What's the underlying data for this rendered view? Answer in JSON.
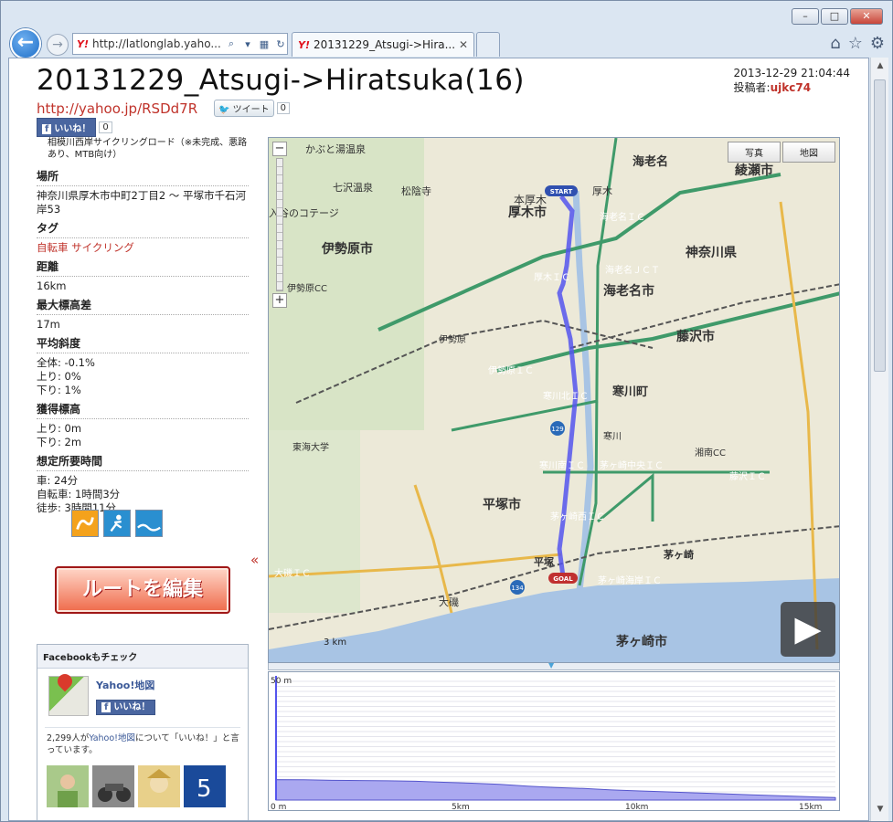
{
  "window": {
    "controls": [
      "–",
      "□",
      "✕"
    ]
  },
  "browser": {
    "url": "http://latlonglab.yaho...",
    "tab_title": "20131229_Atsugi->Hira...",
    "logo": "Y!"
  },
  "page": {
    "title": "20131229_Atsugi->Hiratsuka(16)",
    "datetime": "2013-12-29 21:04:44",
    "poster_label": "投稿者:",
    "poster": "ujkc74",
    "short_url": "http://yahoo.jp/RSDd7R",
    "tweet_label": "ツイート",
    "tweet_count": "0",
    "like_label": "いいね！",
    "like_count": "0",
    "description": "相模川西岸サイクリングロード（※未完成、悪路あり、MTB向け）"
  },
  "details": {
    "location_label": "場所",
    "location": "神奈川県厚木市中町2丁目2 〜 平塚市千石河岸53",
    "tags_label": "タグ",
    "tags": "自転車 サイクリング",
    "distance_label": "距離",
    "distance": "16km",
    "max_elev_label": "最大標高差",
    "max_elev": "17m",
    "slope_label": "平均斜度",
    "slope_all": "全体: -0.1%",
    "slope_up": "上り: 0%",
    "slope_down": "下り: 1%",
    "gain_label": "獲得標高",
    "gain_up": "上り: 0m",
    "gain_down": "下り: 2m",
    "time_label": "想定所要時間",
    "time_car": "車: 24分",
    "time_bike": "自転車: 1時間3分",
    "time_walk": "徒歩: 3時間11分"
  },
  "edit_button": "ルートを編集",
  "collapse": "«",
  "facebook": {
    "header": "Facebookもチェック",
    "page_name": "Yahoo!地図",
    "like_label": "いいね！",
    "count_text": "2,299人が",
    "count_link": "Yahoo!地図",
    "count_rest": "について「いいね！」と言っています。"
  },
  "map": {
    "zoom_in": "+",
    "zoom_out": "−",
    "type_photo": "写真",
    "type_map": "地図",
    "scale": "3 km",
    "start": "START",
    "goal": "GOAL",
    "labels": [
      "かぶと湯温泉",
      "七沢温泉",
      "松陰寺",
      "入谷のコテージ",
      "厚木市",
      "本厚木",
      "厚木",
      "海老名",
      "綾瀬市",
      "海老名ＩＣ",
      "伊勢原市",
      "厚木ＩＣ",
      "海老名ＪＣＴ",
      "神奈川県",
      "伊勢原CC",
      "海老名市",
      "伊勢原",
      "藤沢市",
      "伊勢原ＩＣ",
      "寒川北ＩＣ",
      "寒川町",
      "東海大学",
      "寒川",
      "寒川南ＩＣ",
      "茅ヶ崎中央ＩＣ",
      "藤沢ＩＣ",
      "平塚市",
      "茅ヶ崎西ＩＣ",
      "茅ヶ崎",
      "平塚",
      "茅ヶ崎海岸ＩＣ",
      "大磯ＩＣ",
      "大磯",
      "茅ヶ崎市",
      "湘南CC"
    ],
    "road_signs": [
      "129",
      "134"
    ]
  },
  "elevation": {
    "y_top": "50 m",
    "x_labels": [
      "0 m",
      "5km",
      "10km",
      "15km"
    ],
    "profile": [
      8.5,
      8.4,
      8.2,
      8.1,
      8.0,
      7.8,
      7.4,
      7.0,
      6.5,
      5.8,
      5.2,
      4.8,
      4.2,
      3.8,
      3.4,
      3.0,
      2.6,
      2.2,
      1.8,
      1.4,
      1.0
    ]
  },
  "colors": {
    "accent_red": "#c0332b",
    "route": "#5555ee",
    "elev_fill": "#aaa8f0"
  }
}
